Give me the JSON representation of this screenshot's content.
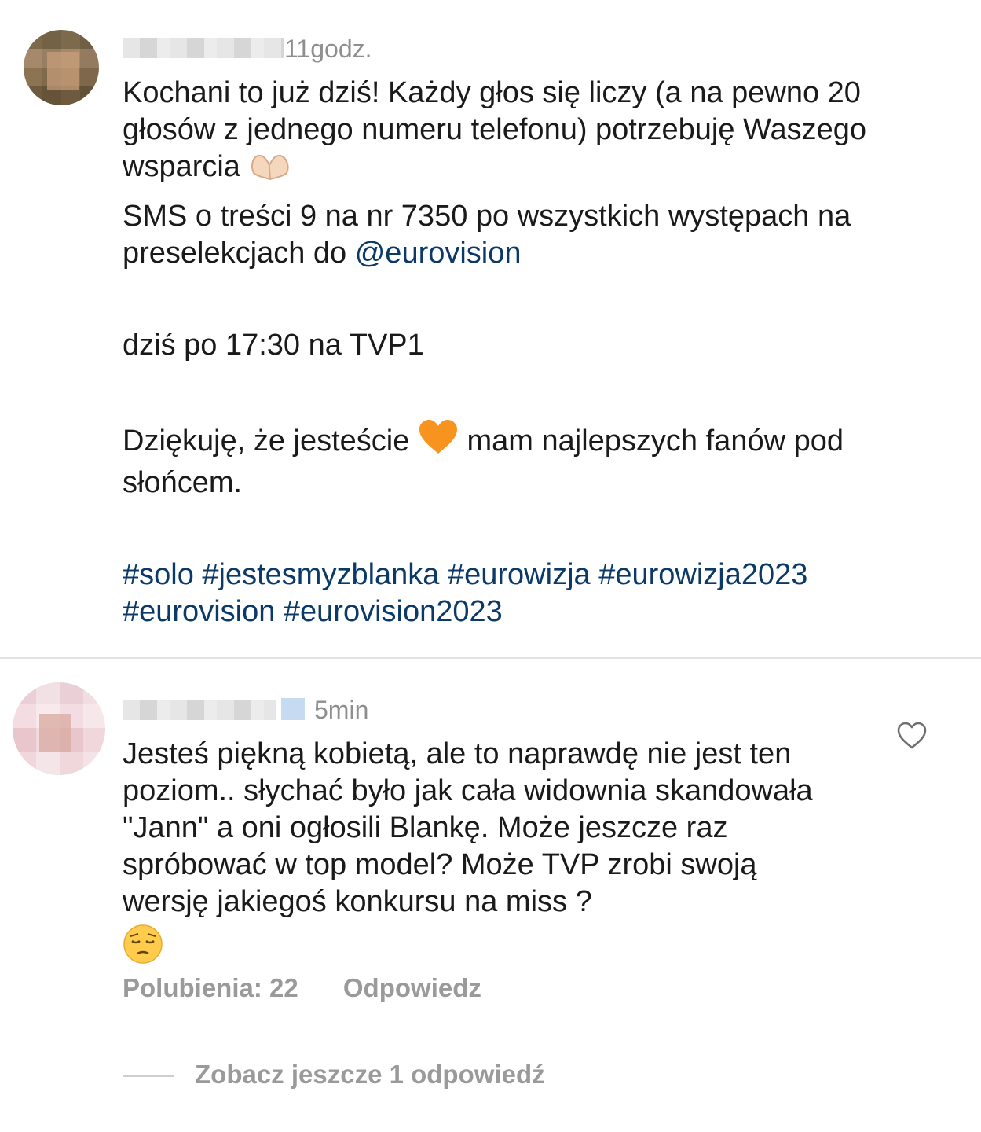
{
  "comments": [
    {
      "time": "11godz.",
      "paragraphs": {
        "p1": "Kochani to już dziś! Każdy głos się liczy (a na pewno 20 głosów z jednego numeru telefonu) potrzebuję Waszego wsparcia",
        "p1_emoji": "🫶🏻",
        "p2_text": "SMS o treści 9 na nr 7350 po wszystkich występach na preselekcjach do ",
        "p2_mention": "@eurovision",
        "p3": "dziś po 17:30 na TVP1",
        "p4_a": "Dziękuję, że jesteście",
        "p4_emoji": "🧡",
        "p4_b": "mam najlepszych fanów pod słońcem.",
        "hashtags_line1": "#solo #jestesmyzblanka #eurowizja #eurowizja2023",
        "hashtags_line2": "#eurovision #eurovision2023"
      }
    },
    {
      "time": "5min",
      "text": "Jesteś piękną kobietą, ale to naprawdę nie jest ten poziom.. słychać było jak cała widownia skandowała \"Jann\" a oni ogłosili Blankę. Może jeszcze raz spróbować w top model? Może TVP zrobi swoją wersję jakiegoś konkursu na miss ?",
      "emoji": "😔",
      "likes_label": "Polubienia: 22",
      "reply_label": "Odpowiedz",
      "view_replies_label": "Zobacz jeszcze 1 odpowiedź",
      "like_icon": "heart-outline-icon"
    }
  ]
}
